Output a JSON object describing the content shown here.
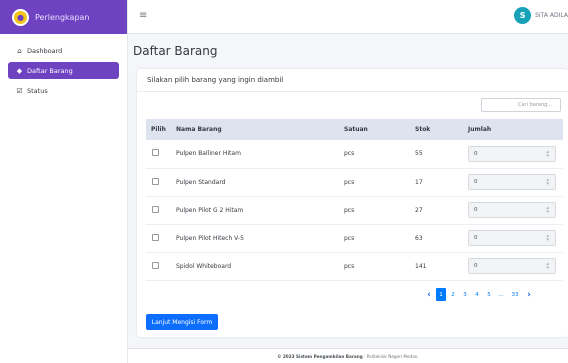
{
  "sidebar": {
    "brand": "Perlengkapan",
    "items": [
      {
        "label": "Dashboard"
      },
      {
        "label": "Daftar Barang"
      },
      {
        "label": "Status"
      }
    ]
  },
  "topbar": {
    "user_initial": "S",
    "user_name": "SITA ADILA"
  },
  "page": {
    "title": "Daftar Barang"
  },
  "card": {
    "header": "Silakan pilih barang yang ingin diambil",
    "search_placeholder": "Cari barang..."
  },
  "table": {
    "headers": [
      "Pilih",
      "Nama Barang",
      "Satuan",
      "Stok",
      "Jumlah"
    ],
    "rows": [
      {
        "name": "Pulpen Balliner Hitam",
        "unit": "pcs",
        "stock": "55",
        "qty": "0"
      },
      {
        "name": "Pulpen Standard",
        "unit": "pcs",
        "stock": "17",
        "qty": "0"
      },
      {
        "name": "Pulpen Pilot G 2 Hitam",
        "unit": "pcs",
        "stock": "27",
        "qty": "0"
      },
      {
        "name": "Pulpen Pilot Hitech V-5",
        "unit": "pcs",
        "stock": "63",
        "qty": "0"
      },
      {
        "name": "Spidol Whiteboard",
        "unit": "pcs",
        "stock": "141",
        "qty": "0"
      }
    ]
  },
  "pagination": {
    "prev": "‹",
    "pages": [
      "1",
      "2",
      "3",
      "4",
      "5",
      "...",
      "33"
    ],
    "next": "›",
    "current": "1"
  },
  "submit_label": "Lanjut Mengisi Form",
  "footer": {
    "copyright": "© 2023 Sistem Pengambilan Barang",
    "org": "· Politeknik Negeri Medan."
  },
  "colors": {
    "brand": "#6f42c1",
    "primary": "#0d6efd",
    "avatar": "#17a2b8"
  },
  "icons": {
    "brand": "logo-icon",
    "menu": "hamburger-icon",
    "dashboard": "home-icon",
    "daftar": "box-icon",
    "status": "checklist-icon"
  }
}
